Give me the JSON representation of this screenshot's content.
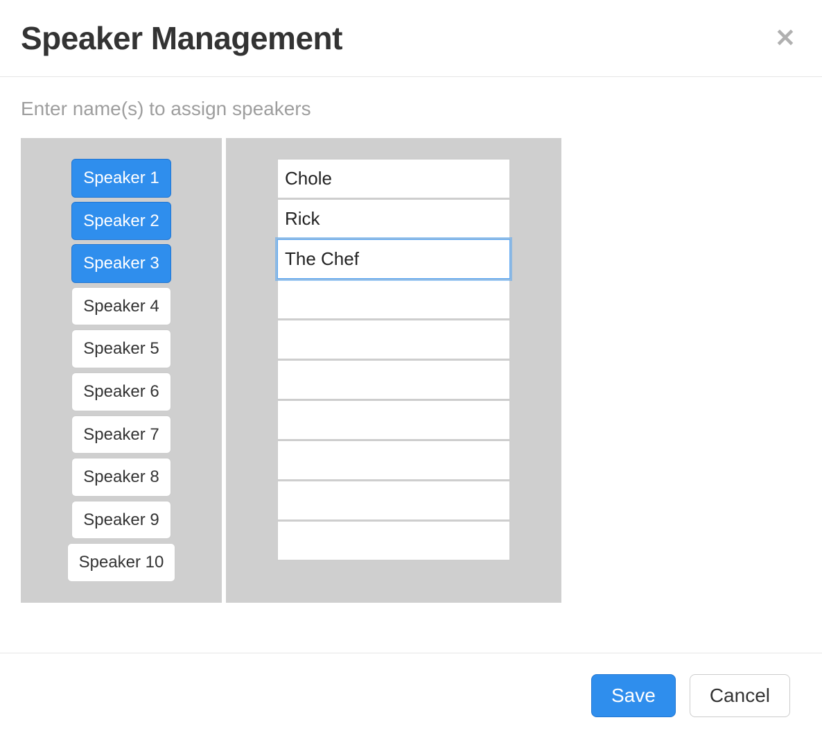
{
  "modal": {
    "title": "Speaker Management",
    "subheading": "Enter name(s) to assign speakers"
  },
  "speakers": [
    {
      "label": "Speaker 1",
      "active": true
    },
    {
      "label": "Speaker 2",
      "active": true
    },
    {
      "label": "Speaker 3",
      "active": true
    },
    {
      "label": "Speaker 4",
      "active": false
    },
    {
      "label": "Speaker 5",
      "active": false
    },
    {
      "label": "Speaker 6",
      "active": false
    },
    {
      "label": "Speaker 7",
      "active": false
    },
    {
      "label": "Speaker 8",
      "active": false
    },
    {
      "label": "Speaker 9",
      "active": false
    },
    {
      "label": "Speaker 10",
      "active": false
    }
  ],
  "names": [
    {
      "value": "Chole",
      "focused": false
    },
    {
      "value": "Rick",
      "focused": false
    },
    {
      "value": "The Chef",
      "focused": true
    },
    {
      "value": "",
      "focused": false
    },
    {
      "value": "",
      "focused": false
    },
    {
      "value": "",
      "focused": false
    },
    {
      "value": "",
      "focused": false
    },
    {
      "value": "",
      "focused": false
    },
    {
      "value": "",
      "focused": false
    },
    {
      "value": "",
      "focused": false
    }
  ],
  "buttons": {
    "save": "Save",
    "cancel": "Cancel"
  }
}
